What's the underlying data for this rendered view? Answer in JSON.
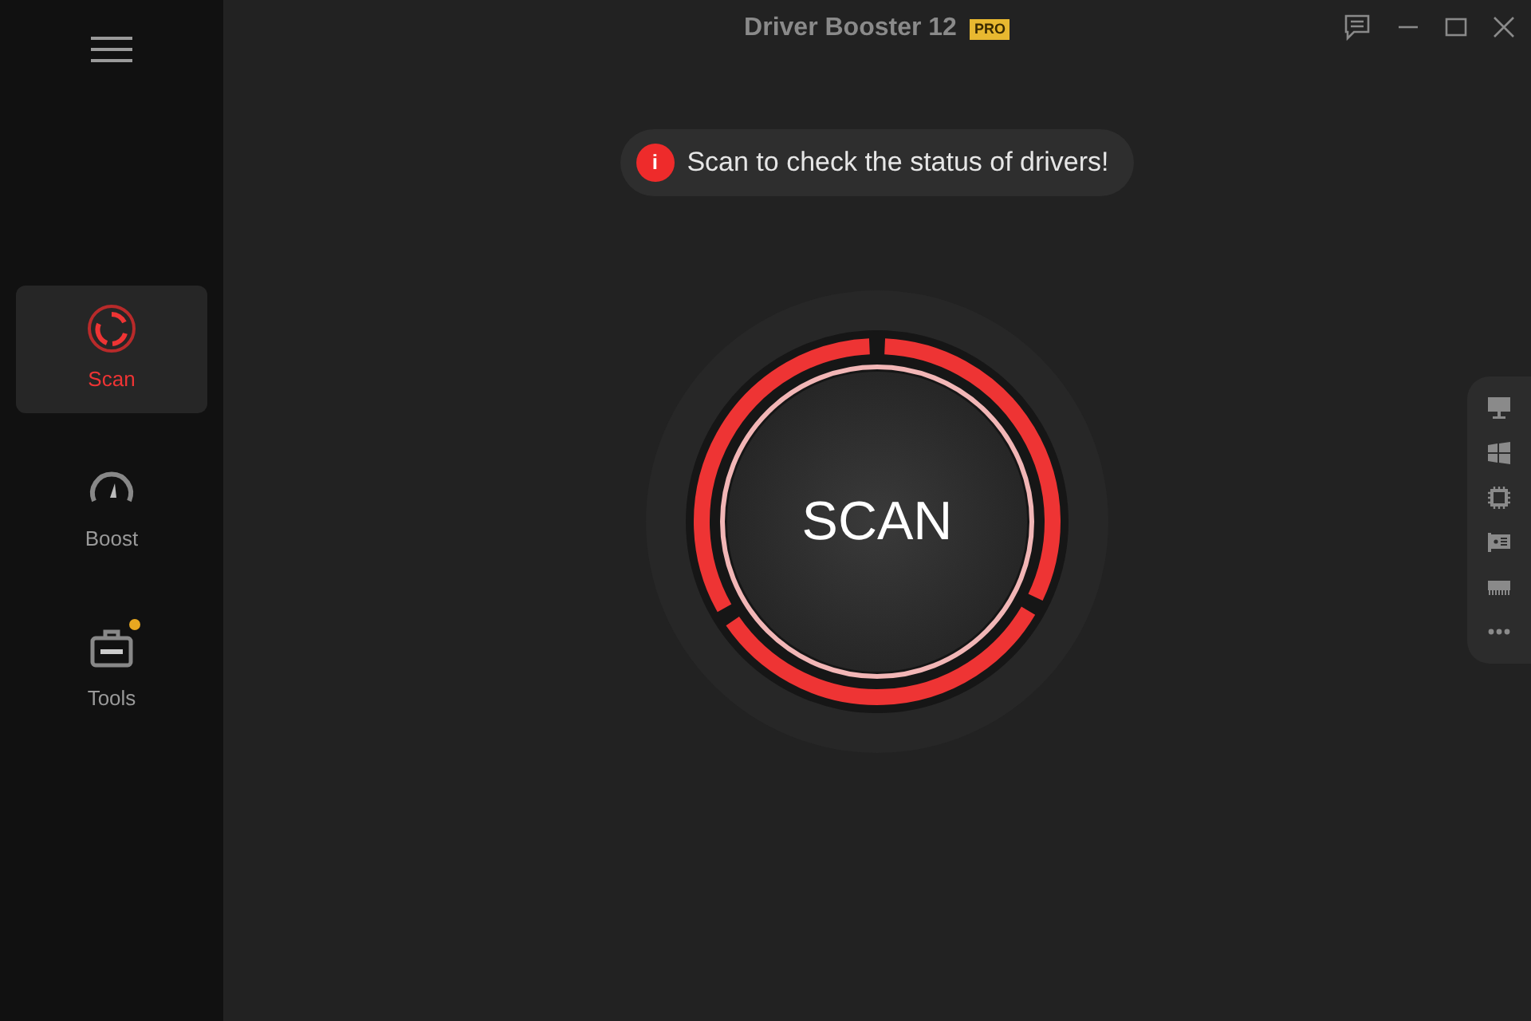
{
  "window": {
    "title": "Driver Booster 12",
    "badge": "PRO"
  },
  "sidebar": {
    "items": [
      {
        "label": "Scan",
        "kind": "scan",
        "selected": true,
        "dot": false
      },
      {
        "label": "Boost",
        "kind": "boost",
        "selected": false,
        "dot": false
      },
      {
        "label": "Tools",
        "kind": "tools",
        "selected": false,
        "dot": true
      }
    ]
  },
  "notice": {
    "icon": "i",
    "text": "Scan to check the status of drivers!"
  },
  "scan_button": {
    "label": "SCAN"
  },
  "side_panel": {
    "items": [
      {
        "kind": "monitor"
      },
      {
        "kind": "windows"
      },
      {
        "kind": "chip"
      },
      {
        "kind": "card"
      },
      {
        "kind": "memory"
      },
      {
        "kind": "more"
      }
    ]
  }
}
